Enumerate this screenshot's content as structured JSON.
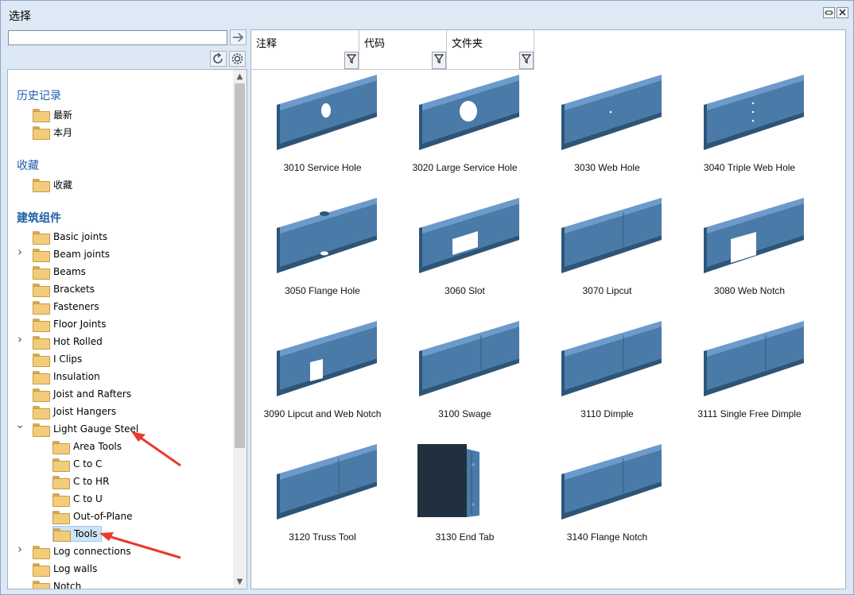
{
  "window": {
    "title": "选择"
  },
  "search": {
    "value": "",
    "placeholder": ""
  },
  "tree": {
    "history": {
      "title": "历史记录",
      "items": [
        "最新",
        "本月"
      ]
    },
    "favorites": {
      "title": "收藏",
      "items": [
        "收藏"
      ]
    },
    "components": {
      "title": "建筑组件",
      "items": [
        {
          "label": "Basic joints",
          "expandable": false
        },
        {
          "label": "Beam joints",
          "expandable": true
        },
        {
          "label": "Beams",
          "expandable": false
        },
        {
          "label": "Brackets",
          "expandable": false
        },
        {
          "label": "Fasteners",
          "expandable": false
        },
        {
          "label": "Floor Joints",
          "expandable": false
        },
        {
          "label": "Hot Rolled",
          "expandable": true
        },
        {
          "label": "I Clips",
          "expandable": false
        },
        {
          "label": "Insulation",
          "expandable": false
        },
        {
          "label": "Joist and Rafters",
          "expandable": false
        },
        {
          "label": "Joist Hangers",
          "expandable": false
        },
        {
          "label": "Light Gauge Steel",
          "expandable": true,
          "expanded": true
        },
        {
          "label": "Area Tools",
          "child": true
        },
        {
          "label": "C to C",
          "child": true
        },
        {
          "label": "C to HR",
          "child": true
        },
        {
          "label": "C to U",
          "child": true
        },
        {
          "label": "Out-of-Plane",
          "child": true
        },
        {
          "label": "Tools",
          "child": true,
          "selected": true
        },
        {
          "label": "Log connections",
          "expandable": true
        },
        {
          "label": "Log walls",
          "expandable": false
        },
        {
          "label": "Notch",
          "expandable": false
        }
      ]
    }
  },
  "filters": [
    {
      "header": "注释",
      "value": ""
    },
    {
      "header": "代码",
      "value": ""
    },
    {
      "header": "文件夹",
      "value": ""
    }
  ],
  "components": [
    {
      "label": "3010 Service Hole",
      "shape": "service-hole"
    },
    {
      "label": "3020 Large Service Hole",
      "shape": "large-hole"
    },
    {
      "label": "3030 Web Hole",
      "shape": "web-hole"
    },
    {
      "label": "3040 Triple Web Hole",
      "shape": "triple-hole"
    },
    {
      "label": "3050 Flange Hole",
      "shape": "flange-hole"
    },
    {
      "label": "3060 Slot",
      "shape": "slot"
    },
    {
      "label": "3070 Lipcut",
      "shape": "lipcut"
    },
    {
      "label": "3080 Web Notch",
      "shape": "web-notch"
    },
    {
      "label": "3090 Lipcut and Web Notch",
      "shape": "lipcut-notch"
    },
    {
      "label": "3100 Swage",
      "shape": "swage"
    },
    {
      "label": "3110 Dimple",
      "shape": "dimple"
    },
    {
      "label": "3111 Single Free Dimple",
      "shape": "single-dimple"
    },
    {
      "label": "3120 Truss Tool",
      "shape": "truss"
    },
    {
      "label": "3130 End Tab",
      "shape": "end-tab"
    },
    {
      "label": "3140 Flange Notch",
      "shape": "flange-notch"
    }
  ],
  "colors": {
    "steel": "#4a7aa8",
    "steel_dark": "#2d5578",
    "steel_light": "#6c9acb",
    "accent_arrow": "#e83a2e",
    "section_title": "#1e5fa8"
  },
  "icons": {
    "go": "arrow-right-icon",
    "refresh": "refresh-icon",
    "settings": "gear-icon",
    "filter": "funnel-icon",
    "folder": "folder-icon"
  }
}
